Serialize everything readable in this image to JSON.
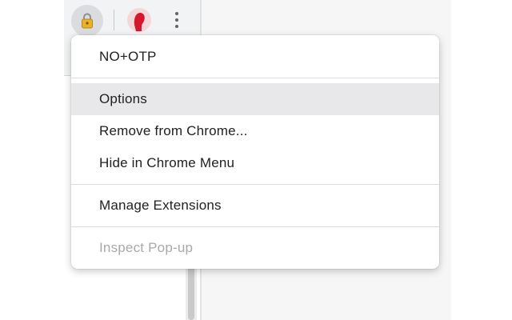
{
  "toolbar": {
    "extension_icon": "lock-extension-icon",
    "profile_icon": "profile-avatar-icon",
    "more_icon": "kebab-menu-icon"
  },
  "menu": {
    "title": "NO+OTP",
    "options": "Options",
    "remove": "Remove from Chrome...",
    "hide": "Hide in Chrome Menu",
    "manage": "Manage Extensions",
    "inspect": "Inspect Pop-up",
    "highlighted_item": "Options",
    "disabled_item": "Inspect Pop-up"
  },
  "colors": {
    "ext_icon_bg": "#dadce0",
    "highlight": "#e8e8ea",
    "avatar_red": "#d6162f",
    "disabled_text": "#a9a9a9"
  }
}
